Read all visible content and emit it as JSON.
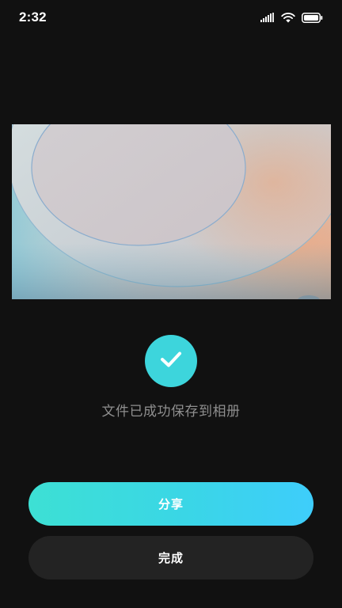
{
  "status_bar": {
    "time": "2:32",
    "icons": [
      "cellular-signal-icon",
      "wifi-icon",
      "battery-icon"
    ]
  },
  "preview": {
    "icon": "wallpaper-preview-image"
  },
  "success": {
    "icon": "checkmark-icon",
    "message": "文件已成功保存到相册",
    "accent_color": "#3dd5dc"
  },
  "actions": {
    "share_label": "分享",
    "done_label": "完成"
  },
  "colors": {
    "background": "#111111",
    "share_gradient_start": "#3de0d4",
    "share_gradient_end": "#3ecdfb",
    "done_button": "#232323",
    "message_text": "#8f8f8f"
  }
}
